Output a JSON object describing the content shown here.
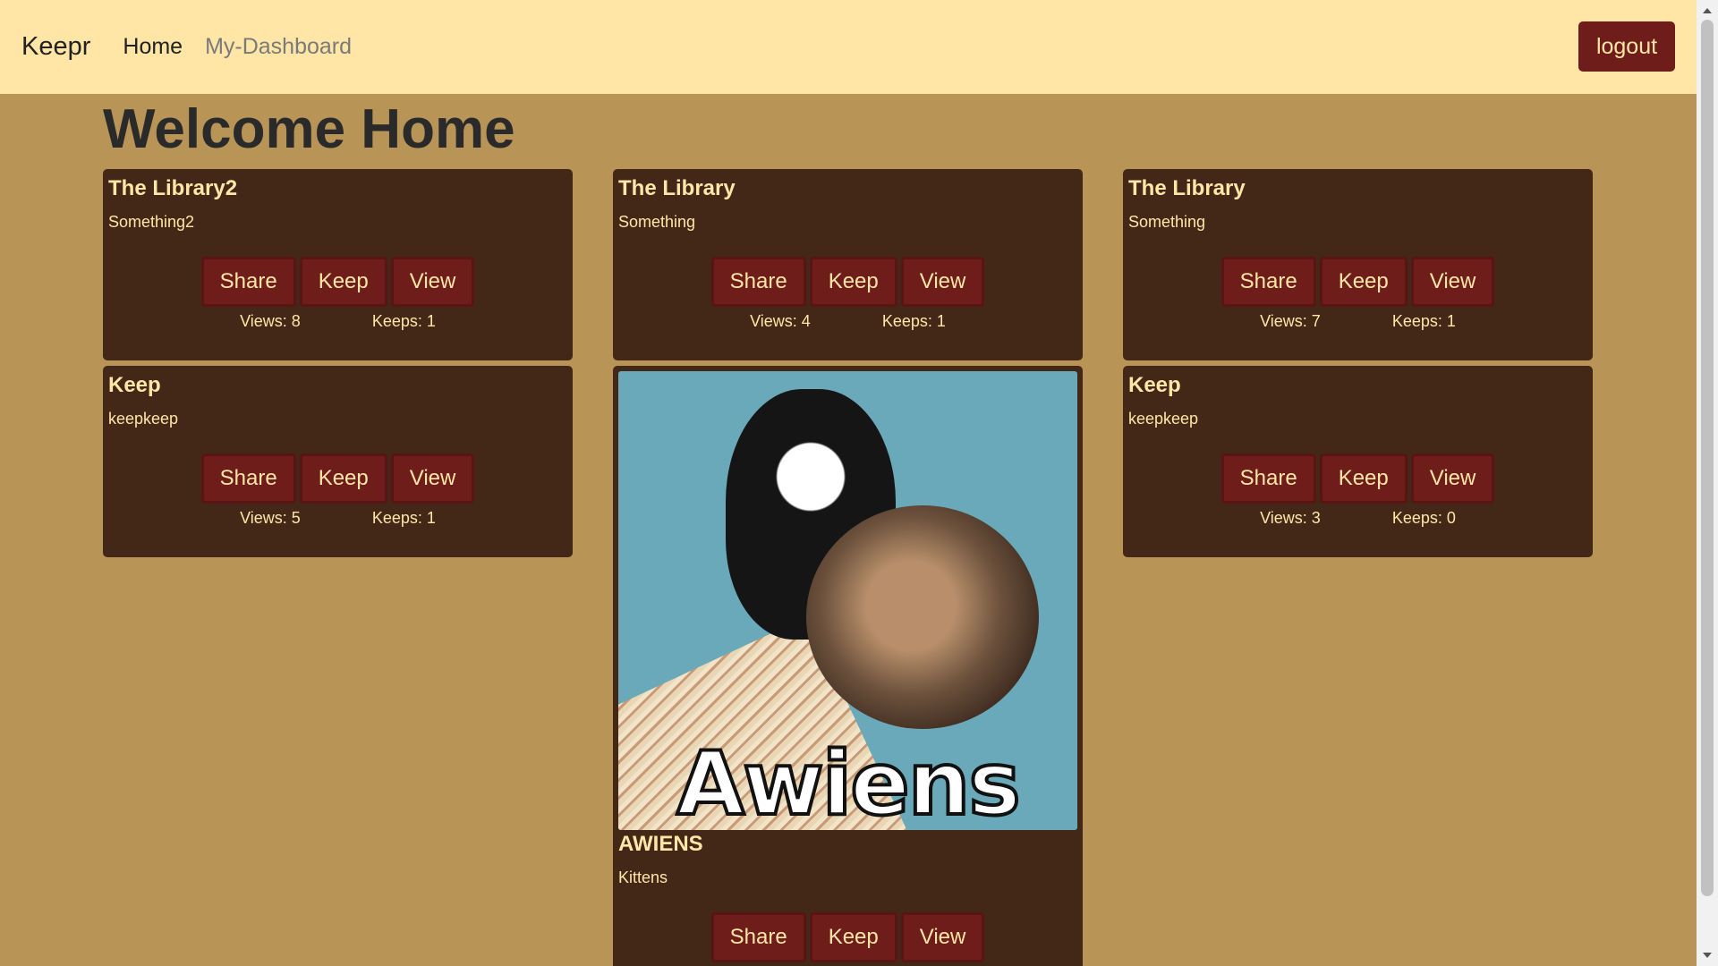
{
  "nav": {
    "brand": "Keepr",
    "links": [
      "Home",
      "My-Dashboard"
    ],
    "logout": "logout"
  },
  "page": {
    "title": "Welcome Home"
  },
  "buttons": {
    "share": "Share",
    "keep": "Keep",
    "view": "View"
  },
  "cards": [
    {
      "title": "The Library2",
      "description": "Something2",
      "views": "Views: 8",
      "keeps": "Keeps: 1"
    },
    {
      "title": "The Library",
      "description": "Something",
      "views": "Views: 4",
      "keeps": "Keeps: 1"
    },
    {
      "title": "The Library",
      "description": "Something",
      "views": "Views: 7",
      "keeps": "Keeps: 1"
    },
    {
      "title": "Keep",
      "description": "keepkeep",
      "views": "Views: 5",
      "keeps": "Keeps: 1"
    },
    {
      "title": "AWIENS",
      "description": "Kittens",
      "image_caption": "Awiens"
    },
    {
      "title": "Keep",
      "description": "keepkeep",
      "views": "Views: 3",
      "keeps": "Keeps: 0"
    }
  ],
  "colors": {
    "navbar": "#ffe6a7",
    "background": "#b99457",
    "card": "#432818",
    "button": "#6f1d1b",
    "text_light": "#ffe6a7"
  }
}
